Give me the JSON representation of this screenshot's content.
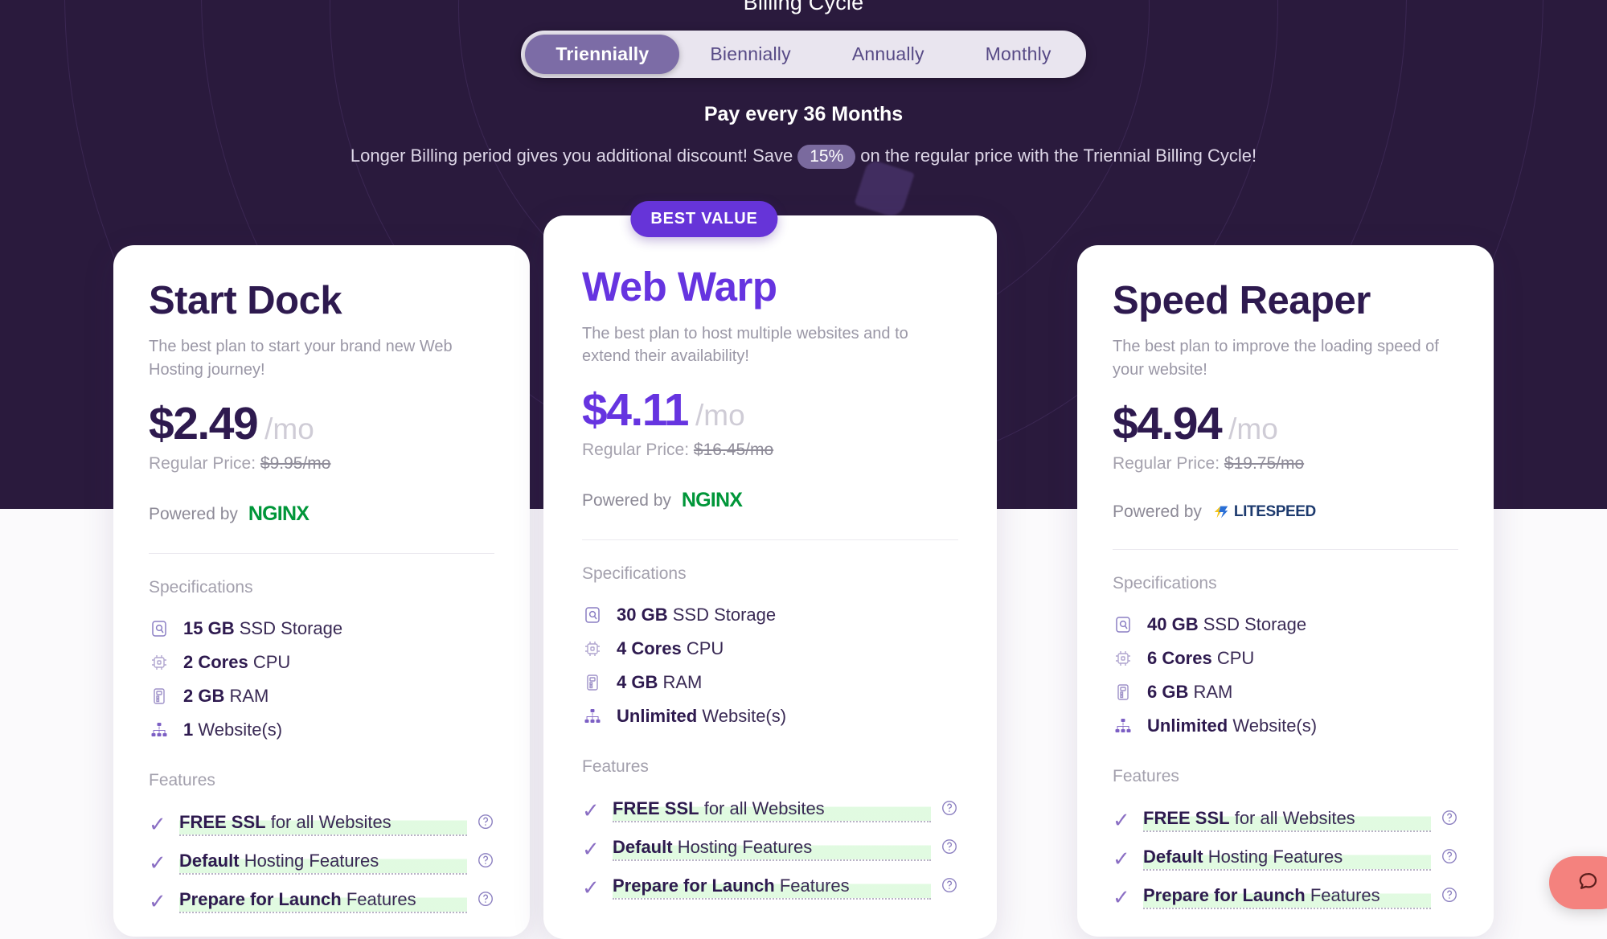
{
  "hero": {
    "billing_title": "Billing Cycle",
    "cycles": [
      {
        "label": "Triennially",
        "active": true
      },
      {
        "label": "Biennially",
        "active": false
      },
      {
        "label": "Annually",
        "active": false
      },
      {
        "label": "Monthly",
        "active": false
      }
    ],
    "pay_every": "Pay every 36 Months",
    "discount_prefix": "Longer Billing period gives you additional discount! Save",
    "discount_badge": "15%",
    "discount_suffix": "on the regular price with the Triennial Billing Cycle!",
    "bg_color": "#2a1a3d"
  },
  "best_badge": "BEST VALUE",
  "labels": {
    "specifications": "Specifications",
    "features": "Features",
    "powered_by": "Powered by",
    "regular_price_prefix": "Regular Price:",
    "per_month": "/mo",
    "help_icon": "?",
    "check_icon": "✓"
  },
  "plans": [
    {
      "name": "Start Dock",
      "description": "The best plan to start your brand new Web Hosting journey!",
      "price": "$2.49",
      "regular_price": "$9.95/mo",
      "engine": "NGINX",
      "specs": [
        {
          "icon": "hard-drive-icon",
          "value": "15 GB",
          "label": "SSD Storage"
        },
        {
          "icon": "cpu-icon",
          "value": "2 Cores",
          "label": "CPU"
        },
        {
          "icon": "ram-icon",
          "value": "2 GB",
          "label": "RAM"
        },
        {
          "icon": "sitemap-icon",
          "value": "1",
          "label": "Website(s)"
        }
      ],
      "features": [
        {
          "value": "FREE SSL",
          "label": "for all Websites"
        },
        {
          "value": "Default",
          "label": "Hosting Features"
        },
        {
          "value": "Prepare for Launch",
          "label": "Features"
        }
      ]
    },
    {
      "name": "Web Warp",
      "description": "The best plan to host multiple websites and to extend their availability!",
      "price": "$4.11",
      "regular_price": "$16.45/mo",
      "engine": "NGINX",
      "specs": [
        {
          "icon": "hard-drive-icon",
          "value": "30 GB",
          "label": "SSD Storage"
        },
        {
          "icon": "cpu-icon",
          "value": "4 Cores",
          "label": "CPU"
        },
        {
          "icon": "ram-icon",
          "value": "4 GB",
          "label": "RAM"
        },
        {
          "icon": "sitemap-icon",
          "value": "Unlimited",
          "label": "Website(s)"
        }
      ],
      "features": [
        {
          "value": "FREE SSL",
          "label": "for all Websites"
        },
        {
          "value": "Default",
          "label": "Hosting Features"
        },
        {
          "value": "Prepare for Launch",
          "label": "Features"
        }
      ]
    },
    {
      "name": "Speed Reaper",
      "description": "The best plan to improve the loading speed of your website!",
      "price": "$4.94",
      "regular_price": "$19.75/mo",
      "engine": "LITESPEED",
      "specs": [
        {
          "icon": "hard-drive-icon",
          "value": "40 GB",
          "label": "SSD Storage"
        },
        {
          "icon": "cpu-icon",
          "value": "6 Cores",
          "label": "CPU"
        },
        {
          "icon": "ram-icon",
          "value": "6 GB",
          "label": "RAM"
        },
        {
          "icon": "sitemap-icon",
          "value": "Unlimited",
          "label": "Website(s)"
        }
      ],
      "features": [
        {
          "value": "FREE SSL",
          "label": "for all Websites"
        },
        {
          "value": "Default",
          "label": "Hosting Features"
        },
        {
          "value": "Prepare for Launch",
          "label": "Features"
        }
      ]
    }
  ],
  "chat_widget": {
    "icon": "chat-bubble-icon",
    "color": "#f4827e"
  },
  "colors": {
    "accent_purple": "#6634e0",
    "dark_purple": "#2e1a4f",
    "nginx_green": "#009639",
    "litespeed_blue": "#1d3a6e"
  }
}
